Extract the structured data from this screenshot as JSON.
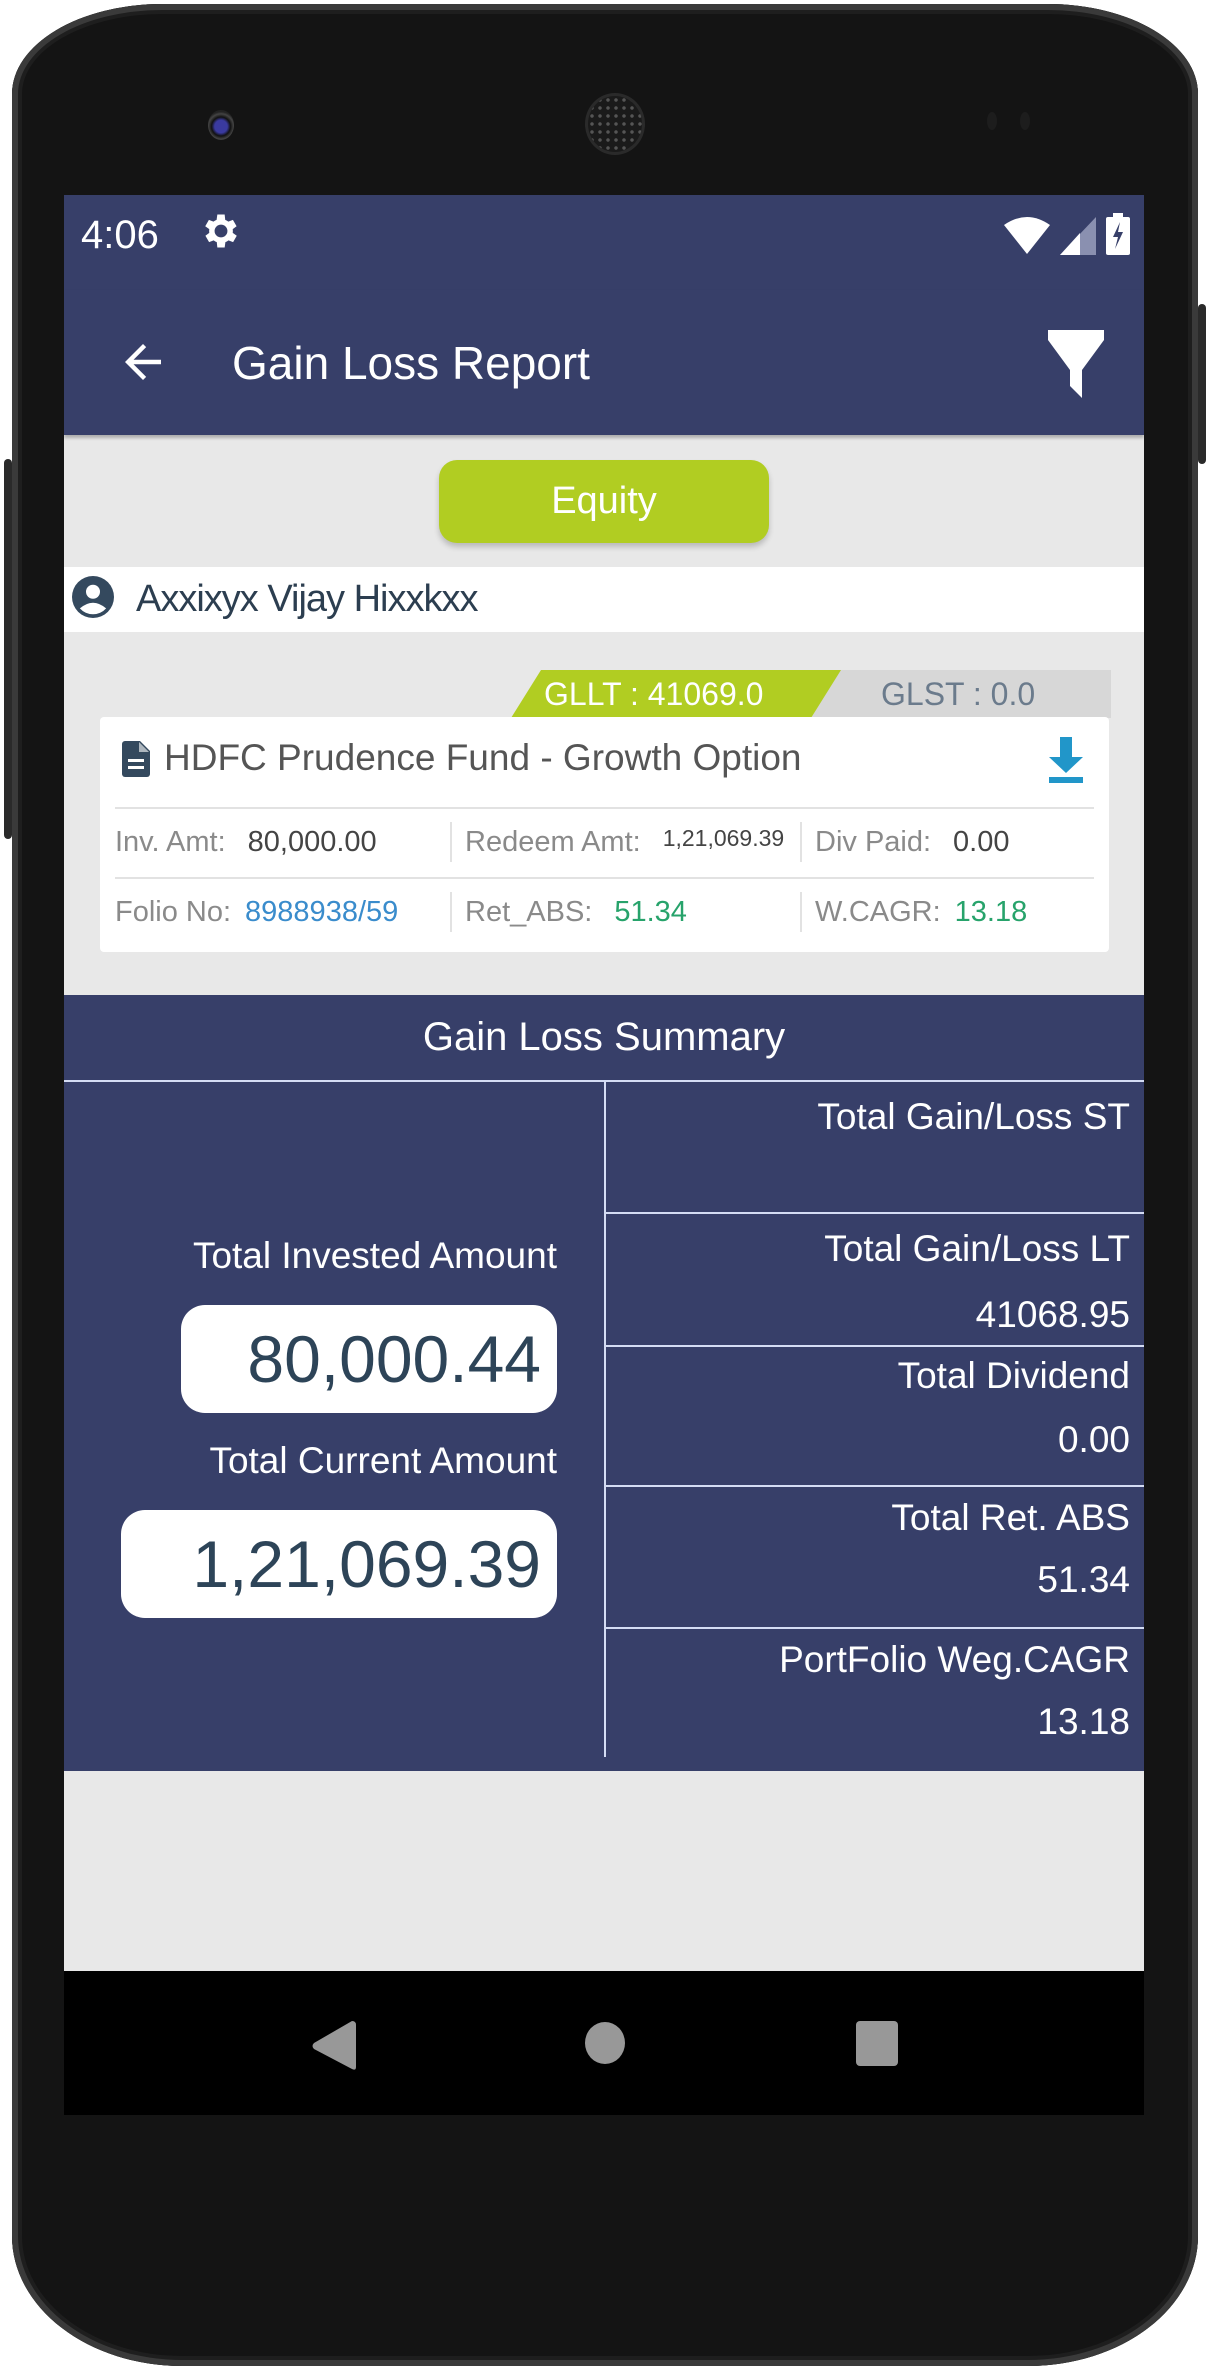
{
  "status_bar": {
    "time": "4:06",
    "icons": [
      "gear-icon",
      "wifi-icon",
      "signal-icon",
      "battery-charging-icon"
    ]
  },
  "app_bar": {
    "title": "Gain Loss Report",
    "back_icon": "arrow-left-icon",
    "filter_icon": "filter-funnel-icon"
  },
  "category_button": {
    "label": "Equity",
    "color": "#b1cd22"
  },
  "investor": {
    "name": "Axxixyx Vijay Hixxkxx",
    "icon": "user-account-icon"
  },
  "fund_card": {
    "tags": {
      "gllt": "GLLT : 41069.0",
      "glst": "GLST : 0.0"
    },
    "fund_name": "HDFC Prudence Fund - Growth Option",
    "doc_icon": "document-icon",
    "download_icon": "download-icon",
    "row1": [
      {
        "label": "Inv. Amt:",
        "value": "80,000.00"
      },
      {
        "label": "Redeem Amt:",
        "value": "1,21,069.39"
      },
      {
        "label": "Div Paid:",
        "value": "0.00"
      }
    ],
    "row2": [
      {
        "label": "Folio No:",
        "value": "8988938/59"
      },
      {
        "label": "Ret_ABS:",
        "value": "51.34"
      },
      {
        "label": "W.CAGR:",
        "value": "13.18"
      }
    ]
  },
  "summary": {
    "title": "Gain Loss Summary",
    "total_invested_label": "Total Invested Amount",
    "total_invested_value": "80,000.44",
    "total_current_label": "Total Current Amount",
    "total_current_value": "1,21,069.39",
    "rows": [
      {
        "label": "Total Gain/Loss ST",
        "value": ""
      },
      {
        "label": "Total Gain/Loss LT",
        "value": "41068.95"
      },
      {
        "label": "Total Dividend",
        "value": "0.00"
      },
      {
        "label": "Total Ret. ABS",
        "value": "51.34"
      },
      {
        "label": "PortFolio Weg.CAGR",
        "value": "13.18"
      }
    ]
  },
  "nav_bar": {
    "buttons": [
      "back",
      "home",
      "recents"
    ]
  },
  "colors": {
    "primary": "#373f69",
    "accent": "#b1cd22",
    "link": "#3a8ccc",
    "positive": "#27a36b"
  }
}
